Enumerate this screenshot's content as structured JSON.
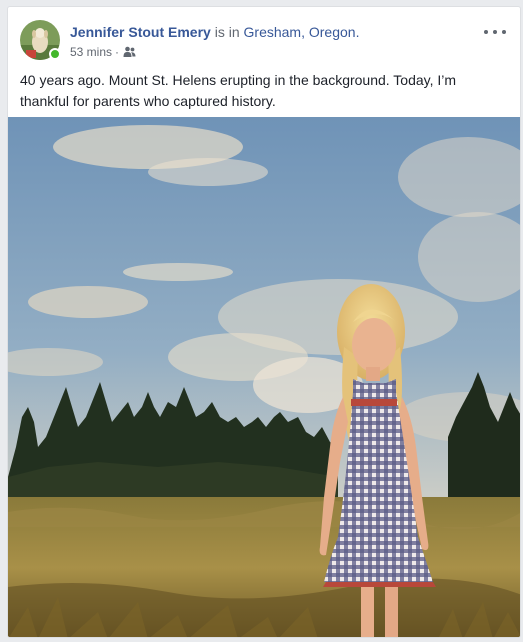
{
  "post": {
    "author": "Jennifer Stout Emery",
    "connector": "is in",
    "location": "Gresham, Oregon.",
    "timestamp": "53 mins",
    "separator": "·",
    "audience_icon": "friends-icon",
    "more_icon": "more-options-icon",
    "text": "40 years ago. Mount St. Helens erupting in the background. Today, I’m thankful for parents who captured history."
  },
  "colors": {
    "author_link": "#385898",
    "online": "#42b72a",
    "text": "#1d2129",
    "meta": "#616770"
  }
}
